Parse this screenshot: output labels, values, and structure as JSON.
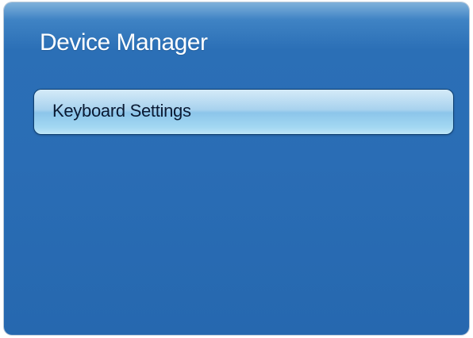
{
  "window": {
    "title": "Device Manager"
  },
  "menu": {
    "items": [
      {
        "label": "Keyboard Settings",
        "selected": true
      }
    ]
  },
  "colors": {
    "background": "#2a6db5",
    "selected_item": "#a8d2ee",
    "title_text": "#ffffff"
  }
}
